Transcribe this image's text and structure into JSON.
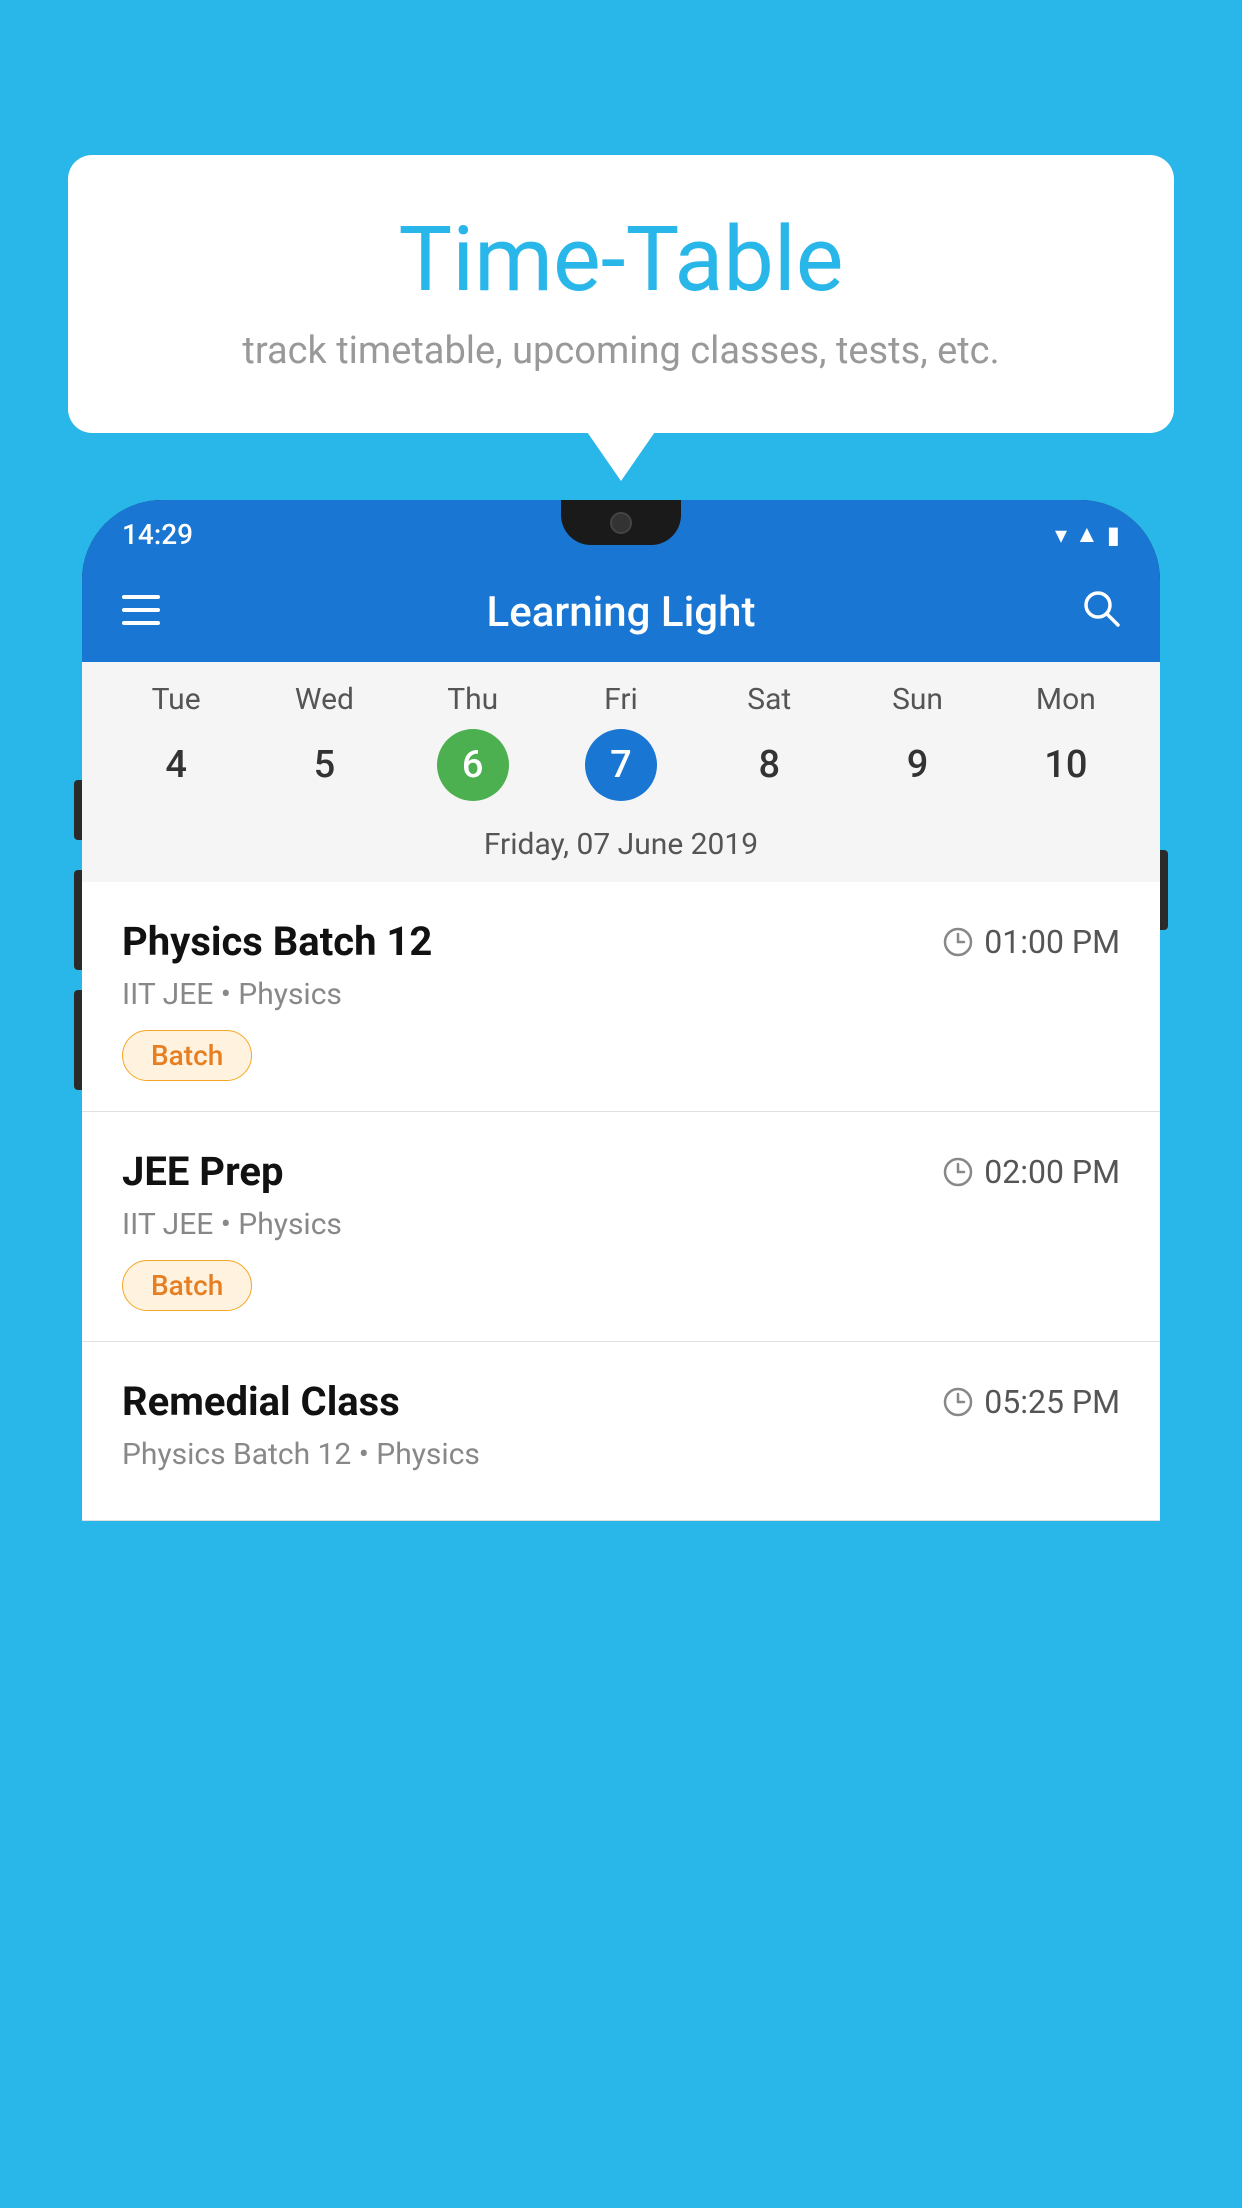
{
  "page": {
    "background_color": "#29B6E8"
  },
  "speech_bubble": {
    "title": "Time-Table",
    "subtitle": "track timetable, upcoming classes, tests, etc."
  },
  "status_bar": {
    "time": "14:29"
  },
  "app_bar": {
    "title": "Learning Light"
  },
  "calendar": {
    "selected_date_label": "Friday, 07 June 2019",
    "days": [
      {
        "name": "Tue",
        "number": "4",
        "state": "normal"
      },
      {
        "name": "Wed",
        "number": "5",
        "state": "normal"
      },
      {
        "name": "Thu",
        "number": "6",
        "state": "today"
      },
      {
        "name": "Fri",
        "number": "7",
        "state": "selected"
      },
      {
        "name": "Sat",
        "number": "8",
        "state": "normal"
      },
      {
        "name": "Sun",
        "number": "9",
        "state": "normal"
      },
      {
        "name": "Mon",
        "number": "10",
        "state": "normal"
      }
    ]
  },
  "classes": [
    {
      "name": "Physics Batch 12",
      "time": "01:00 PM",
      "subtitle": "IIT JEE • Physics",
      "badge": "Batch"
    },
    {
      "name": "JEE Prep",
      "time": "02:00 PM",
      "subtitle": "IIT JEE • Physics",
      "badge": "Batch"
    },
    {
      "name": "Remedial Class",
      "time": "05:25 PM",
      "subtitle": "Physics Batch 12 • Physics",
      "badge": null
    }
  ]
}
